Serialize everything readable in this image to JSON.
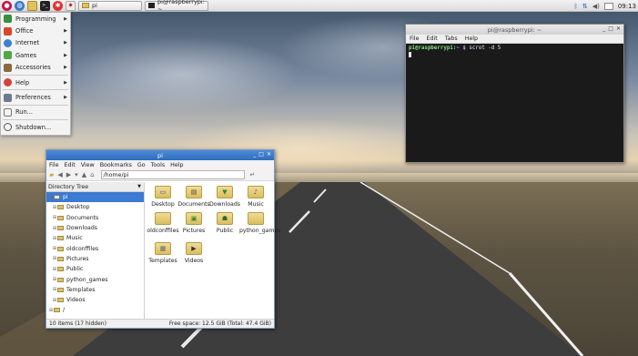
{
  "taskbar": {
    "tasks": [
      {
        "label": "pi"
      },
      {
        "label": "pi@raspberrypi: ~"
      }
    ],
    "clock": "09:13"
  },
  "menu": {
    "items": [
      {
        "label": "Programming"
      },
      {
        "label": "Office"
      },
      {
        "label": "Internet"
      },
      {
        "label": "Games"
      },
      {
        "label": "Accessories"
      },
      {
        "label": "Help"
      },
      {
        "label": "Preferences"
      },
      {
        "label": "Run..."
      },
      {
        "label": "Shutdown..."
      }
    ]
  },
  "terminal": {
    "title": "pi@raspberrypi: ~",
    "menu": [
      "File",
      "Edit",
      "Tabs",
      "Help"
    ],
    "prompt_user": "pi@raspberrypi",
    "prompt_path": "~ $",
    "command": "scrot -d 5"
  },
  "filemanager": {
    "title": "pi",
    "menu": [
      "File",
      "Edit",
      "View",
      "Bookmarks",
      "Go",
      "Tools",
      "Help"
    ],
    "address": "/home/pi",
    "sidebar_header": "Directory Tree",
    "tree": [
      {
        "label": "pi",
        "selected": true,
        "indent": 1
      },
      {
        "label": "Desktop",
        "indent": 2
      },
      {
        "label": "Documents",
        "indent": 2
      },
      {
        "label": "Downloads",
        "indent": 2
      },
      {
        "label": "Music",
        "indent": 2
      },
      {
        "label": "oldconffiles",
        "indent": 2
      },
      {
        "label": "Pictures",
        "indent": 2
      },
      {
        "label": "Public",
        "indent": 2
      },
      {
        "label": "python_games",
        "indent": 2
      },
      {
        "label": "Templates",
        "indent": 2
      },
      {
        "label": "Videos",
        "indent": 2
      },
      {
        "label": "/",
        "indent": 0
      }
    ],
    "files": [
      {
        "label": "Desktop"
      },
      {
        "label": "Documents"
      },
      {
        "label": "Downloads"
      },
      {
        "label": "Music"
      },
      {
        "label": "oldconffiles"
      },
      {
        "label": "Pictures"
      },
      {
        "label": "Public"
      },
      {
        "label": "python_games"
      },
      {
        "label": "Templates"
      },
      {
        "label": "Videos"
      }
    ],
    "status_left": "10 items (17 hidden)",
    "status_right": "Free space: 12.5 GiB (Total: 47.4 GiB)"
  }
}
